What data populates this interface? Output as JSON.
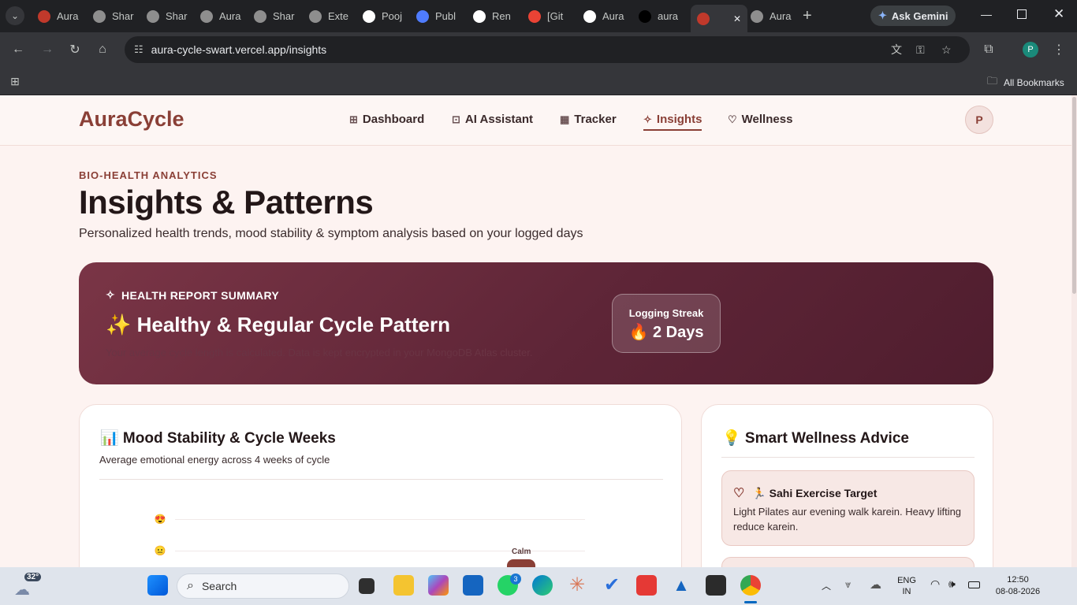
{
  "browser": {
    "tabs": [
      {
        "label": "Aura",
        "color": "#c0392b"
      },
      {
        "label": "Shar",
        "color": "#8e8e8e"
      },
      {
        "label": "Shar",
        "color": "#8e8e8e"
      },
      {
        "label": "Aura",
        "color": "#8e8e8e"
      },
      {
        "label": "Shar",
        "color": "#8e8e8e"
      },
      {
        "label": "Exte",
        "color": "#8e8e8e"
      },
      {
        "label": "Pooj",
        "color": "#ffffff"
      },
      {
        "label": "Publ",
        "color": "#4f7cff"
      },
      {
        "label": "Ren",
        "color": "#ffffff"
      },
      {
        "label": "[Git",
        "color": "#ea4335"
      },
      {
        "label": "Aura",
        "color": "#ffffff"
      },
      {
        "label": "aura",
        "color": "#000000"
      },
      {
        "label": "",
        "color": "#c0392b"
      },
      {
        "label": "Aura",
        "color": "#8e8e8e"
      }
    ],
    "ask_gemini": "Ask Gemini",
    "url": "aura-cycle-swart.vercel.app/insights",
    "all_bookmarks": "All Bookmarks",
    "profile_initial": "P"
  },
  "nav": {
    "logo": "AuraCycle",
    "links": [
      "Dashboard",
      "AI Assistant",
      "Tracker",
      "Insights",
      "Wellness"
    ],
    "active": "Insights",
    "avatar": "P"
  },
  "header": {
    "eyebrow": "BIO-HEALTH ANALYTICS",
    "title": "Insights & Patterns",
    "subtitle": "Personalized health trends, mood stability & symptom analysis based on your logged days"
  },
  "summary": {
    "heading": "HEALTH REPORT SUMMARY",
    "title": "✨ Healthy & Regular Cycle Pattern",
    "description": "Your average cycle length is calculated. Data is kept encrypted in your MongoDB Atlas cluster.",
    "streak_label": "Logging Streak",
    "streak_value": "🔥 2 Days"
  },
  "mood_card": {
    "title": "📊 Mood Stability & Cycle Weeks",
    "subtitle": "Average emotional energy across 4 weeks of cycle",
    "bar_label": "Calm",
    "emoji_high": "😍",
    "emoji_mid": "😐"
  },
  "advice_card": {
    "title": "💡 Smart Wellness Advice",
    "items": [
      {
        "title": "🏃 Sahi Exercise Target",
        "text": "Light Pilates aur evening walk karein. Heavy lifting reduce karein."
      }
    ]
  },
  "taskbar": {
    "weather": "32°",
    "search_placeholder": "Search",
    "whatsapp_badge": "3",
    "lang_line1": "ENG",
    "lang_line2": "IN",
    "time": "12:50",
    "date": "08-08-2026"
  }
}
